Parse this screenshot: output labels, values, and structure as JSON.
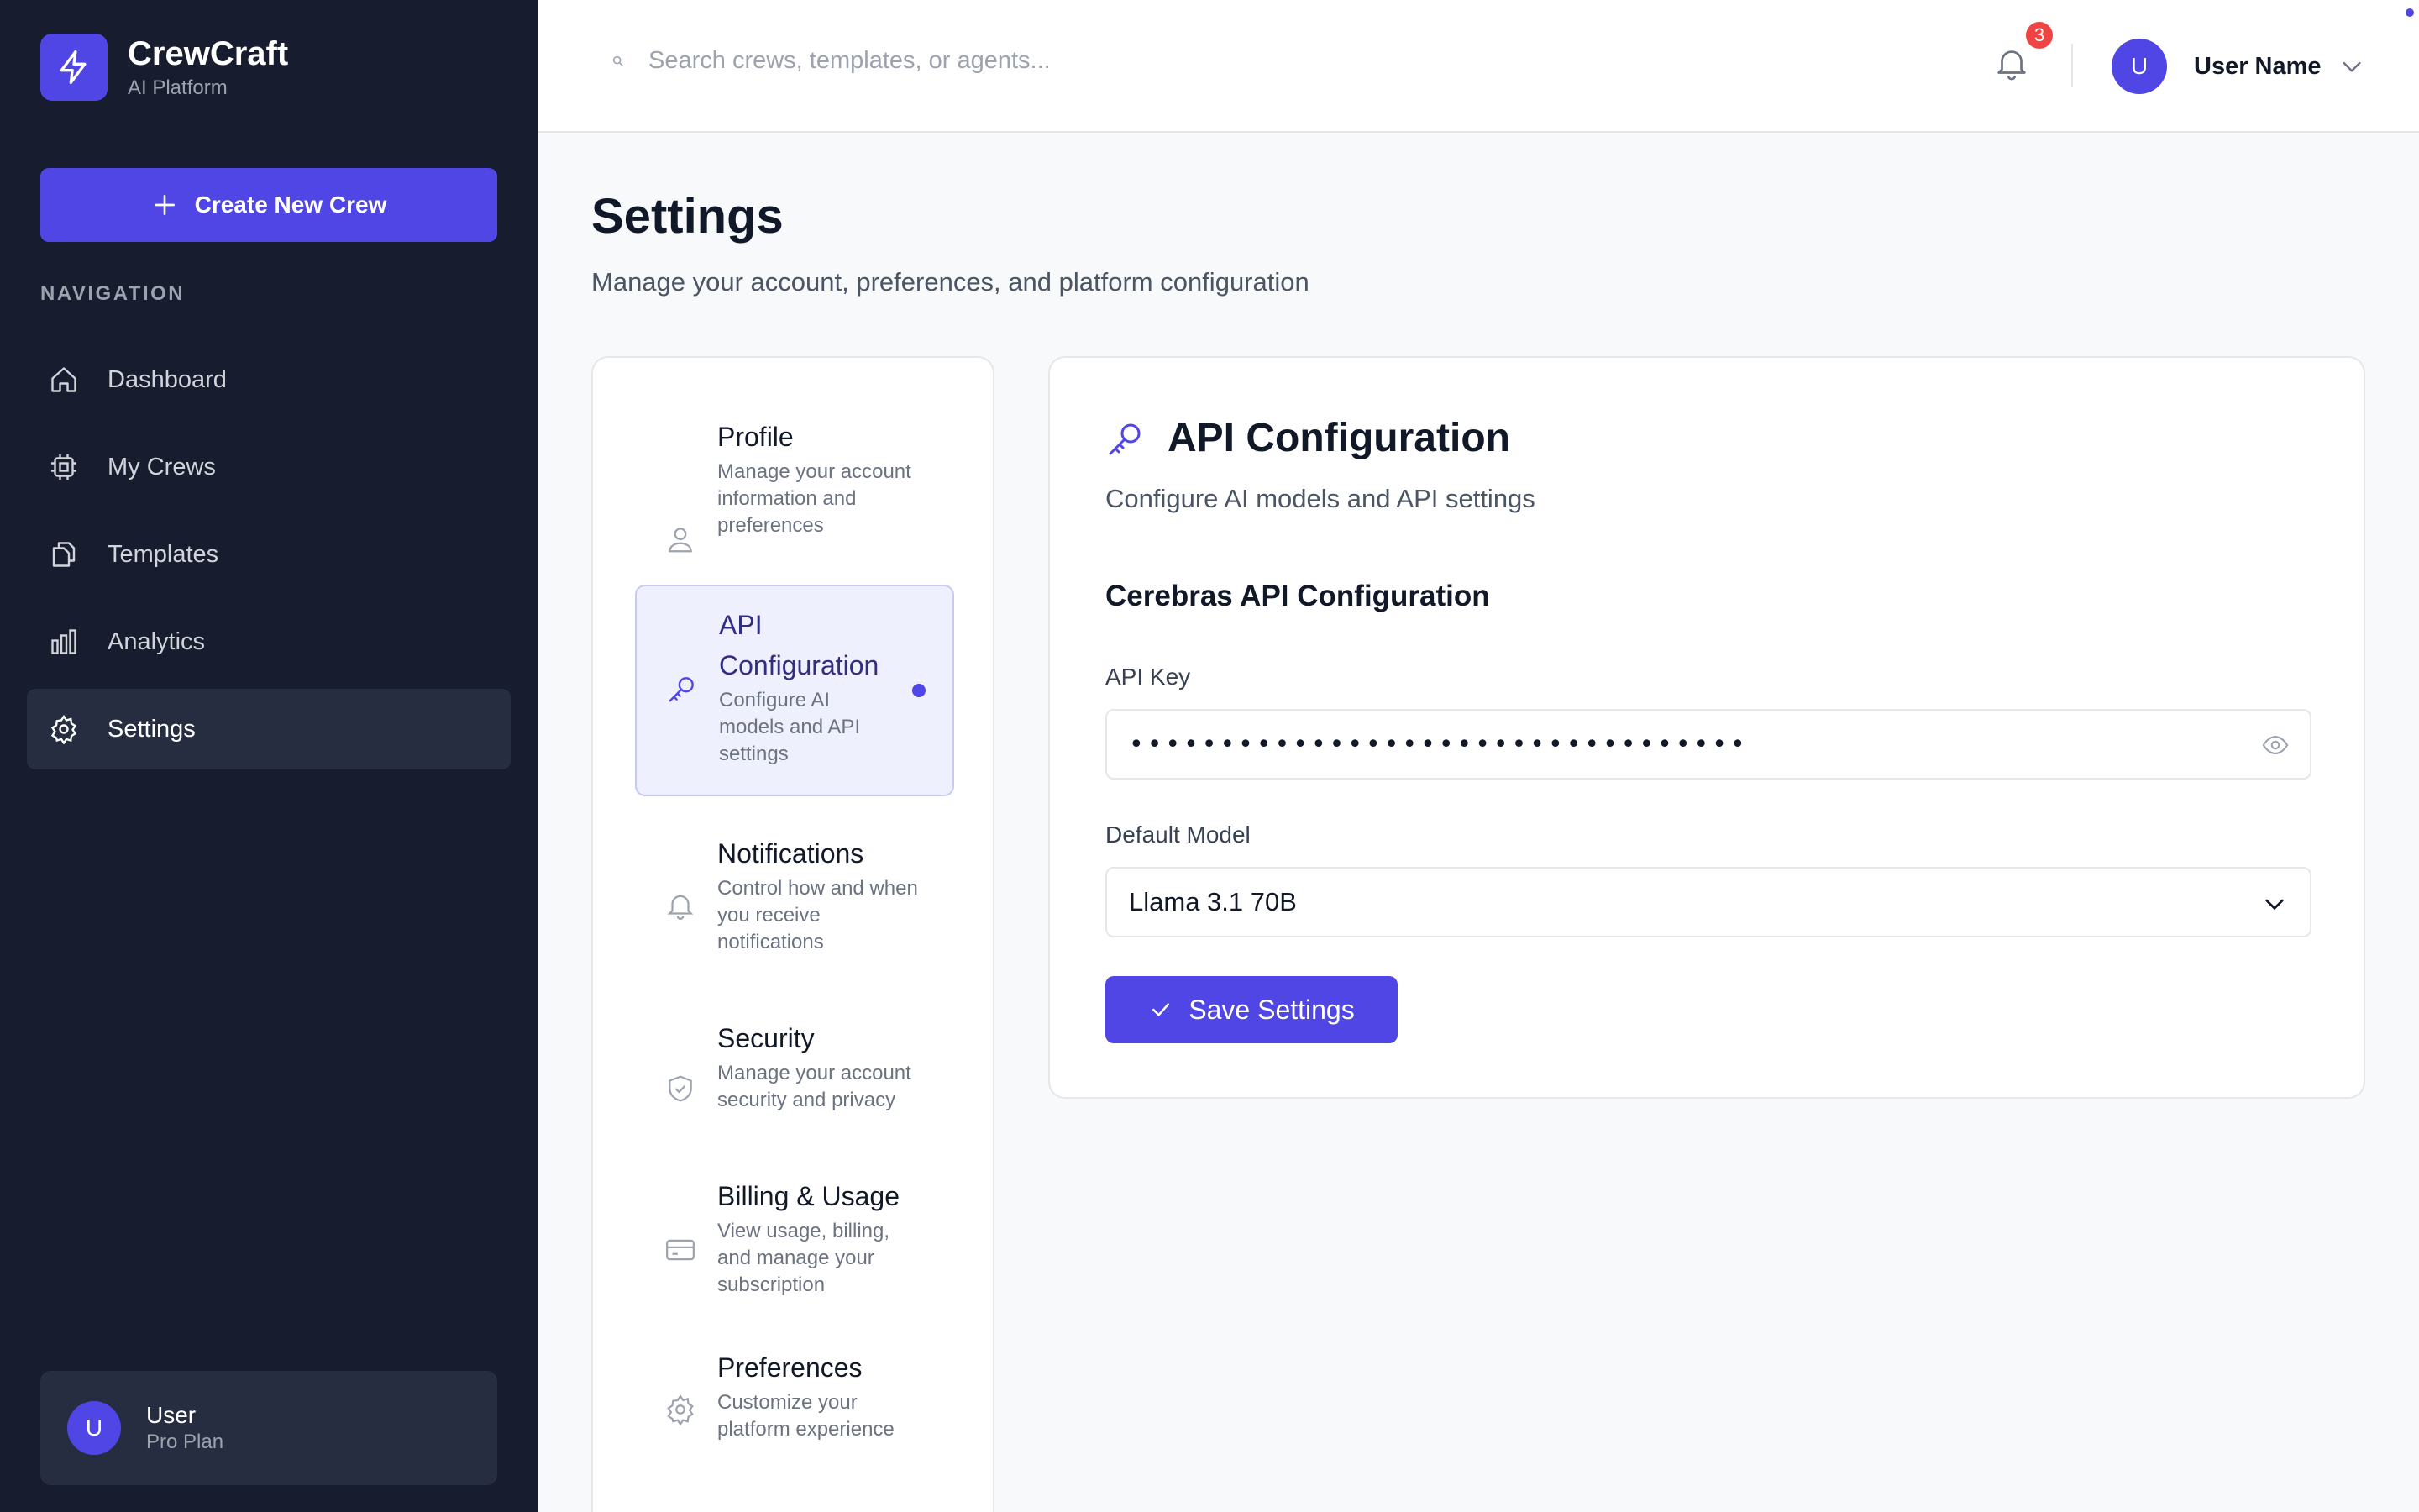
{
  "brand": {
    "name": "CrewCraft",
    "subtitle": "AI Platform"
  },
  "sidebar": {
    "create_label": "Create New Crew",
    "nav_heading": "NAVIGATION",
    "items": [
      {
        "label": "Dashboard",
        "icon": "home-icon"
      },
      {
        "label": "My Crews",
        "icon": "cpu-icon"
      },
      {
        "label": "Templates",
        "icon": "copy-icon"
      },
      {
        "label": "Analytics",
        "icon": "bar-chart-icon"
      },
      {
        "label": "Settings",
        "icon": "gear-icon",
        "active": true
      }
    ],
    "user": {
      "initial": "U",
      "name": "User",
      "plan": "Pro Plan"
    }
  },
  "topbar": {
    "search_placeholder": "Search crews, templates, or agents...",
    "notification_count": "3",
    "user_initial": "U",
    "user_name": "User Name"
  },
  "page": {
    "title": "Settings",
    "subtitle": "Manage your account, preferences, and platform configuration"
  },
  "settings_nav": [
    {
      "title": "Profile",
      "desc": "Manage your account information and preferences",
      "icon": "user-icon"
    },
    {
      "title": "API Configuration",
      "desc": "Configure AI models and API settings",
      "icon": "key-icon",
      "active": true
    },
    {
      "title": "Notifications",
      "desc": "Control how and when you receive notifications",
      "icon": "bell-icon"
    },
    {
      "title": "Security",
      "desc": "Manage your account security and privacy",
      "icon": "shield-icon"
    },
    {
      "title": "Billing & Usage",
      "desc": "View usage, billing, and manage your subscription",
      "icon": "credit-card-icon"
    },
    {
      "title": "Preferences",
      "desc": "Customize your platform experience",
      "icon": "gear-icon"
    }
  ],
  "panel": {
    "title": "API Configuration",
    "subtitle": "Configure AI models and API settings",
    "section_title": "Cerebras API Configuration",
    "api_key_label": "API Key",
    "api_key_value": "••••••••••••••••••••••••••••••••••",
    "model_label": "Default Model",
    "model_value": "Llama 3.1 70B",
    "save_label": "Save Settings"
  },
  "colors": {
    "accent": "#4f46e5",
    "sidebar_bg": "#171c2e",
    "badge": "#ef4444"
  }
}
